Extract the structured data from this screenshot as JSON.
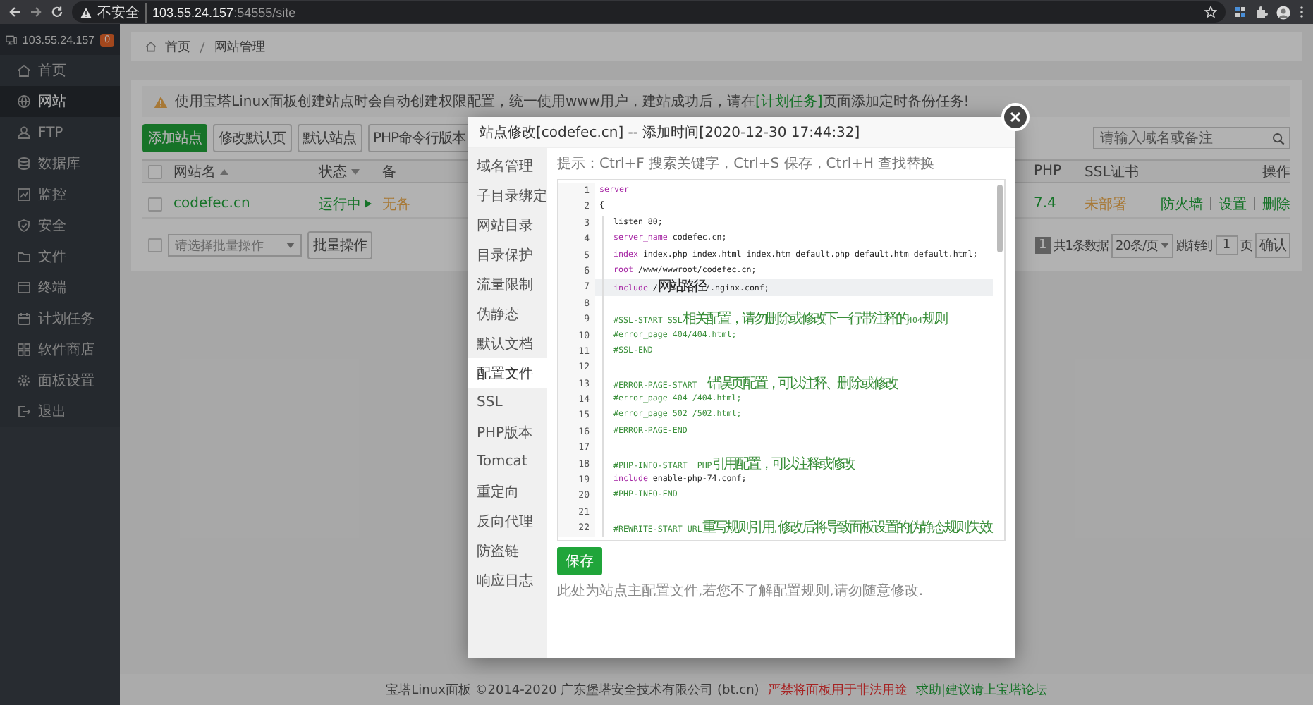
{
  "browser": {
    "security_label": "不安全",
    "url_host": "103.55.24.157",
    "url_path": ":54555/site"
  },
  "sidebar": {
    "host": "103.55.24.157",
    "badge": "0",
    "items": [
      {
        "label": "首页",
        "selected": false
      },
      {
        "label": "网站",
        "selected": true
      },
      {
        "label": "FTP",
        "selected": false
      },
      {
        "label": "数据库",
        "selected": false
      },
      {
        "label": "监控",
        "selected": false
      },
      {
        "label": "安全",
        "selected": false
      },
      {
        "label": "文件",
        "selected": false
      },
      {
        "label": "终端",
        "selected": false
      },
      {
        "label": "计划任务",
        "selected": false
      },
      {
        "label": "软件商店",
        "selected": false
      },
      {
        "label": "面板设置",
        "selected": false
      },
      {
        "label": "退出",
        "selected": false
      }
    ]
  },
  "breadcrumb": [
    "首页",
    "网站管理"
  ],
  "notice": {
    "before": "使用宝塔Linux面板创建站点时会自动创建权限配置，统一使用www用户，建站成功后，请在",
    "link": "[计划任务]",
    "after": "页面添加定时备份任务!"
  },
  "toolbar": {
    "buttons": [
      {
        "label": "添加站点",
        "primary": true
      },
      {
        "label": "修改默认页",
        "primary": false
      },
      {
        "label": "默认站点",
        "primary": false
      },
      {
        "label": "PHP命令行版本",
        "primary": false
      }
    ],
    "search_placeholder": "请输入域名或备注"
  },
  "table": {
    "select_all_checked": false,
    "columns": [
      {
        "label": "网站名",
        "sortable": true,
        "ascending": true
      },
      {
        "label": "状态",
        "sortable": true,
        "ascending": false
      },
      {
        "label": "备",
        "sortable": false
      },
      {
        "label": "PHP",
        "sortable": false
      },
      {
        "label": "SSL证书",
        "sortable": false
      },
      {
        "label": "操作",
        "sortable": false
      }
    ],
    "rows": [
      {
        "checked": false,
        "name": "codefec.cn",
        "status": "运行中",
        "backup": "无备",
        "php": "7.4",
        "ssl": "未部署",
        "actions": [
          "防火墙",
          "设置",
          "删除"
        ]
      }
    ]
  },
  "batch": {
    "checked": false,
    "select_placeholder": "请选择批量操作",
    "button": "批量操作"
  },
  "pagination": {
    "current": "1",
    "total": "共1条数据",
    "page_size": "20条/页",
    "jump_label": "跳转到",
    "jump_value": "1",
    "page_unit": "页",
    "confirm": "确认"
  },
  "dialog": {
    "title": "站点修改[codefec.cn] -- 添加时间[2020-12-30 17:44:32]",
    "nav": [
      {
        "label": "域名管理",
        "selected": false
      },
      {
        "label": "子目录绑定",
        "selected": false
      },
      {
        "label": "网站目录",
        "selected": false
      },
      {
        "label": "目录保护",
        "selected": false
      },
      {
        "label": "流量限制",
        "selected": false
      },
      {
        "label": "伪静态",
        "selected": false
      },
      {
        "label": "默认文档",
        "selected": false
      },
      {
        "label": "配置文件",
        "selected": true
      },
      {
        "label": "SSL",
        "selected": false
      },
      {
        "label": "PHP版本",
        "selected": false
      },
      {
        "label": "Tomcat",
        "selected": false
      },
      {
        "label": "重定向",
        "selected": false
      },
      {
        "label": "反向代理",
        "selected": false
      },
      {
        "label": "防盗链",
        "selected": false
      },
      {
        "label": "响应日志",
        "selected": false
      }
    ],
    "hint": "提示：Ctrl+F 搜索关键字，Ctrl+S 保存，Ctrl+H 查找替换",
    "code_lines": [
      {
        "number": "1",
        "indented": false,
        "active": false,
        "tokens": [
          {
            "kind": "keyword",
            "text": "server"
          }
        ]
      },
      {
        "number": "2",
        "indented": false,
        "active": false,
        "tokens": [
          {
            "kind": "plain",
            "text": "{"
          }
        ]
      },
      {
        "number": "3",
        "indented": true,
        "active": false,
        "tokens": [
          {
            "kind": "plain",
            "text": "listen 80;"
          }
        ]
      },
      {
        "number": "4",
        "indented": true,
        "active": false,
        "tokens": [
          {
            "kind": "keyword",
            "text": "server_name"
          },
          {
            "kind": "plain",
            "text": " codefec.cn;"
          }
        ]
      },
      {
        "number": "5",
        "indented": true,
        "active": false,
        "tokens": [
          {
            "kind": "keyword",
            "text": "index"
          },
          {
            "kind": "plain",
            "text": " index.php index.html index.htm default.php default.htm default.html;"
          }
        ]
      },
      {
        "number": "6",
        "indented": true,
        "active": false,
        "tokens": [
          {
            "kind": "keyword",
            "text": "root"
          },
          {
            "kind": "plain",
            "text": " /www/wwwroot/codefec.cn;"
          }
        ]
      },
      {
        "number": "7",
        "indented": true,
        "active": true,
        "tokens": [
          {
            "kind": "keyword",
            "text": "include"
          },
          {
            "kind": "plain",
            "text": " /网站路径/.nginx.conf;"
          }
        ]
      },
      {
        "number": "8",
        "indented": true,
        "active": false
      },
      {
        "number": "9",
        "indented": true,
        "active": false,
        "tokens": [
          {
            "kind": "comment",
            "text": "#SSL-START SSL相关配置，请勿删除或修改下一行带注释的404规则"
          }
        ]
      },
      {
        "number": "10",
        "indented": true,
        "active": false,
        "tokens": [
          {
            "kind": "comment",
            "text": "#error_page 404/404.html;"
          }
        ]
      },
      {
        "number": "11",
        "indented": true,
        "active": false,
        "tokens": [
          {
            "kind": "comment",
            "text": "#SSL-END"
          }
        ]
      },
      {
        "number": "12",
        "indented": true,
        "active": false
      },
      {
        "number": "13",
        "indented": true,
        "active": false,
        "tokens": [
          {
            "kind": "comment",
            "text": "#ERROR-PAGE-START  错误页配置，可以注释、删除或修改"
          }
        ]
      },
      {
        "number": "14",
        "indented": true,
        "active": false,
        "tokens": [
          {
            "kind": "comment",
            "text": "#error_page 404 /404.html;"
          }
        ]
      },
      {
        "number": "15",
        "indented": true,
        "active": false,
        "tokens": [
          {
            "kind": "comment",
            "text": "#error_page 502 /502.html;"
          }
        ]
      },
      {
        "number": "16",
        "indented": true,
        "active": false,
        "tokens": [
          {
            "kind": "comment",
            "text": "#ERROR-PAGE-END"
          }
        ]
      },
      {
        "number": "17",
        "indented": true,
        "active": false
      },
      {
        "number": "18",
        "indented": true,
        "active": false,
        "tokens": [
          {
            "kind": "comment",
            "text": "#PHP-INFO-START  PHP引用配置，可以注释或修改"
          }
        ]
      },
      {
        "number": "19",
        "indented": true,
        "active": false,
        "tokens": [
          {
            "kind": "keyword",
            "text": "include"
          },
          {
            "kind": "plain",
            "text": " enable-php-74.conf;"
          }
        ]
      },
      {
        "number": "20",
        "indented": true,
        "active": false,
        "tokens": [
          {
            "kind": "comment",
            "text": "#PHP-INFO-END"
          }
        ]
      },
      {
        "number": "21",
        "indented": true,
        "active": false
      },
      {
        "number": "22",
        "indented": true,
        "active": false,
        "tokens": [
          {
            "kind": "comment",
            "text": "#REWRITE-START URL重写规则引用,修改后将导致面板设置的伪静态规则失效"
          }
        ]
      }
    ],
    "save": "保存",
    "note": "此处为站点主配置文件,若您不了解配置规则,请勿随意修改."
  },
  "footer": {
    "copyright": "宝塔Linux面板 ©2014-2020 广东堡塔安全技术有限公司 (bt.cn)",
    "warning": "严禁将面板用于非法用途",
    "help": "求助|建议请上宝塔论坛"
  }
}
